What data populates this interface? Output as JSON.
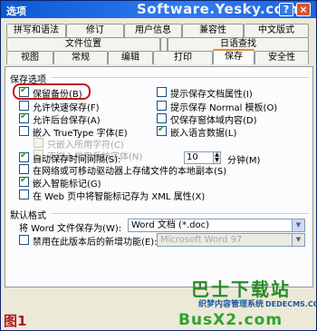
{
  "window": {
    "title": "选项",
    "watermark": "Software.Yesky.com",
    "help_label": "?",
    "close_label": "×"
  },
  "tabs": {
    "row1": [
      "拼写和语法",
      "修订",
      "用户信息",
      "兼容性",
      "中文版式"
    ],
    "row2": [
      "文件位置",
      "",
      "日语查找"
    ],
    "row3": [
      "视图",
      "常规",
      "编辑",
      "打印",
      "保存",
      "安全性"
    ]
  },
  "active_tab": "保存",
  "save_options": {
    "section_label": "保存选项",
    "left": [
      {
        "label": "保留备份(B)",
        "checked": true,
        "disabled": false
      },
      {
        "label": "允许快速保存(F)",
        "checked": false,
        "disabled": false
      },
      {
        "label": "允许后台保存(A)",
        "checked": true,
        "disabled": false
      },
      {
        "label": "嵌入 TrueType 字体(E)",
        "checked": false,
        "disabled": false
      },
      {
        "label": "只嵌入所用字符(C)",
        "checked": false,
        "disabled": true
      },
      {
        "label": "不嵌入常用系统字体(N)",
        "checked": false,
        "disabled": true
      }
    ],
    "right": [
      {
        "label": "提示保存文档属性(I)",
        "checked": false
      },
      {
        "label": "提示保存 Normal 模板(O)",
        "checked": false
      },
      {
        "label": "仅保存窗体域内容(D)",
        "checked": false
      },
      {
        "label": "嵌入语言数据(L)",
        "checked": true
      }
    ],
    "network_copy": {
      "label": "在网络或可移动驱动器上存储文件的本地副本(S)",
      "checked": false
    },
    "autosave": {
      "label": "自动保存时间间隔(S):",
      "checked": true,
      "value": "10",
      "unit": "分钟(M)"
    },
    "smart_tags": {
      "label": "嵌入智能标记(G)",
      "checked": true
    },
    "web_xml": {
      "label": "在 Web 页中将智能标记存为 XML 属性(X)",
      "checked": false
    }
  },
  "default_format": {
    "section_label": "默认格式",
    "save_as_label": "将 Word 文件保存为(W):",
    "save_as_value": "Word 文档 (*.doc)",
    "disable_features_label": "禁用在此版本后的新增功能(E):",
    "disable_features_value": "Microsoft Word 97"
  },
  "figure_label": "图1",
  "site_watermark": {
    "main": "巴士下载站",
    "sub": "织梦内容管理系统",
    "domain": "BusX2.com",
    "domain_alt": "DEDECMS.COM"
  }
}
